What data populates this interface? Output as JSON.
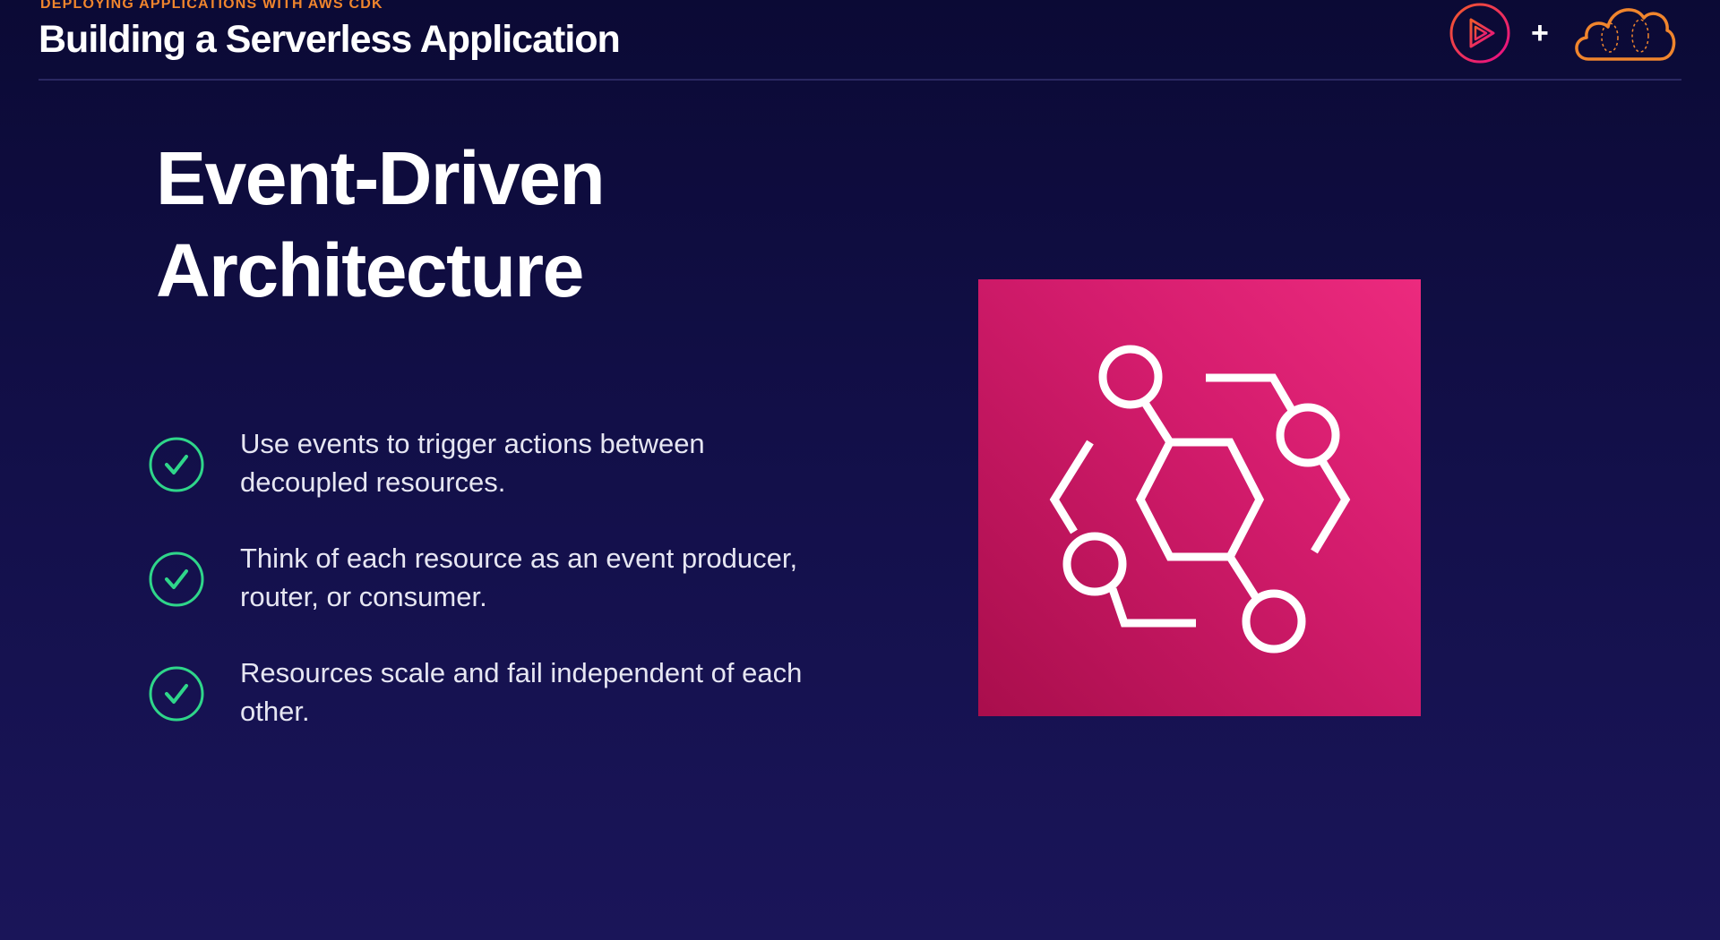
{
  "header": {
    "eyebrow": "DEPLOYING APPLICATIONS WITH AWS CDK",
    "course_title": "Building a Serverless Application",
    "plus": "+"
  },
  "logos": {
    "left_icon": "play-logo-icon",
    "right_icon": "cloud-logo-icon"
  },
  "slide": {
    "title_line1": "Event-Driven",
    "title_line2": "Architecture",
    "bullets": [
      {
        "icon": "check-icon",
        "text": "Use events to trigger actions between decoupled resources."
      },
      {
        "icon": "check-icon",
        "text": "Think of each resource as an event producer, router, or consumer."
      },
      {
        "icon": "check-icon",
        "text": "Resources scale and fail independent of each other."
      }
    ]
  },
  "service_tile": {
    "icon": "eventbridge-icon"
  },
  "colors": {
    "accent_orange": "#f0852d",
    "accent_pink": "#ec2a7e",
    "check_green": "#2fd68a",
    "background": "#120f48"
  }
}
